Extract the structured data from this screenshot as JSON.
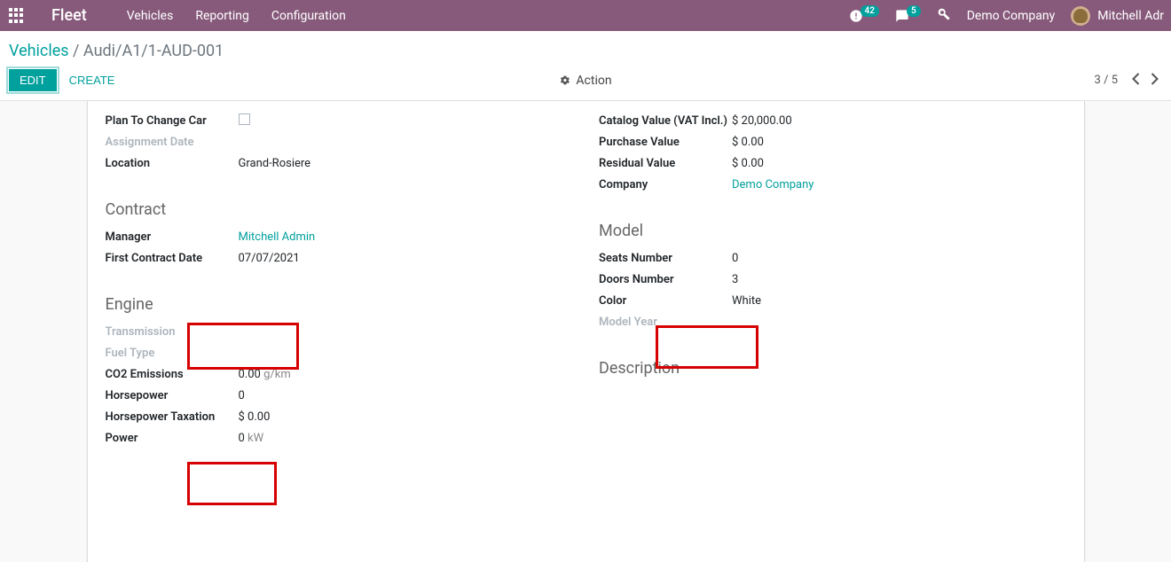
{
  "topnav": {
    "brand": "Fleet",
    "menu": [
      "Vehicles",
      "Reporting",
      "Configuration"
    ],
    "activity_badge": "42",
    "messages_badge": "5",
    "company": "Demo Company",
    "user_name": "Mitchell Adr"
  },
  "breadcrumb": {
    "root": "Vehicles",
    "current": "Audi/A1/1-AUD-001"
  },
  "buttons": {
    "edit": "EDIT",
    "create": "CREATE",
    "action": "Action"
  },
  "pager": {
    "current": "3",
    "total": "5"
  },
  "sections": {
    "left_top": [
      {
        "label": "Plan To Change Car",
        "value_type": "checkbox"
      },
      {
        "label": "Assignment Date",
        "muted": true
      },
      {
        "label": "Location",
        "value": "Grand-Rosiere"
      }
    ],
    "right_top": [
      {
        "label": "Catalog Value (VAT Incl.)",
        "value": "$ 20,000.00"
      },
      {
        "label": "Purchase Value",
        "value": "$ 0.00"
      },
      {
        "label": "Residual Value",
        "value": "$ 0.00"
      },
      {
        "label": "Company",
        "value": "Demo Company",
        "link": true
      }
    ],
    "contract_title": "Contract",
    "contract": [
      {
        "label": "Manager",
        "value": "Mitchell Admin",
        "link": true
      },
      {
        "label": "First Contract Date",
        "value": "07/07/2021"
      }
    ],
    "model_title": "Model",
    "model": [
      {
        "label": "Seats Number",
        "value": "0"
      },
      {
        "label": "Doors Number",
        "value": "3"
      },
      {
        "label": "Color",
        "value": "White"
      },
      {
        "label": "Model Year",
        "muted": true
      }
    ],
    "engine_title": "Engine",
    "engine": [
      {
        "label": "Transmission",
        "muted": true
      },
      {
        "label": "Fuel Type",
        "muted": true
      },
      {
        "label": "CO2 Emissions",
        "value": "0.00",
        "unit": "g/km"
      },
      {
        "label": "Horsepower",
        "value": "0"
      },
      {
        "label": "Horsepower Taxation",
        "value": "$ 0.00"
      },
      {
        "label": "Power",
        "value": "0",
        "unit": "kW"
      }
    ],
    "description_title": "Description"
  }
}
